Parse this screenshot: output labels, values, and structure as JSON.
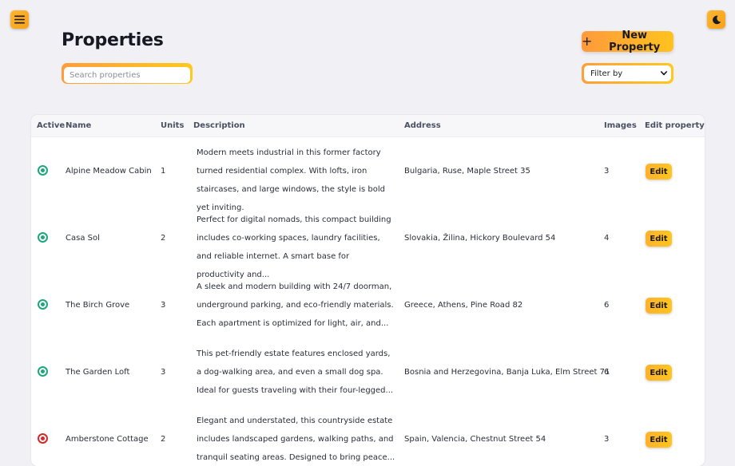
{
  "header": {
    "title": "Properties",
    "new_property_label": "New Property",
    "new_property_icon": "plus-icon",
    "menu_icon": "hamburger-menu-icon",
    "theme_icon": "moon-icon"
  },
  "search": {
    "placeholder": "Search properties",
    "value": ""
  },
  "filter": {
    "selected": "Filter by",
    "icon": "chevron-down-icon"
  },
  "table": {
    "columns": [
      "Active",
      "Name",
      "Units",
      "Description",
      "Address",
      "Images",
      "Edit property"
    ],
    "edit_label": "Edit",
    "rows": [
      {
        "active": true,
        "name": "Alpine Meadow Cabin",
        "units": "1",
        "description": "Modern meets industrial in this former factory turned residential complex. With lofts, iron staircases, and large windows, the style is bold yet inviting.",
        "address": "Bulgaria, Ruse, Maple Street 35",
        "images": "3"
      },
      {
        "active": true,
        "name": "Casa Sol",
        "units": "2",
        "description": "Perfect for digital nomads, this compact building includes co-working spaces, laundry facilities, and reliable internet. A smart base for productivity and...",
        "address": "Slovakia, Žilina, Hickory Boulevard 54",
        "images": "4"
      },
      {
        "active": true,
        "name": "The Birch Grove",
        "units": "3",
        "description": "A sleek and modern building with 24/7 doorman, underground parking, and eco-friendly materials. Each apartment is optimized for light, air, and...",
        "address": "Greece, Athens, Pine Road 82",
        "images": "6"
      },
      {
        "active": true,
        "name": "The Garden Loft",
        "units": "3",
        "description": "This pet-friendly estate features enclosed yards, a dog-walking area, and even a small dog spa. Ideal for guests traveling with their four-legged...",
        "address": "Bosnia and Herzegovina, Banja Luka, Elm Street 71",
        "images": "6"
      },
      {
        "active": false,
        "name": "Amberstone Cottage",
        "units": "2",
        "description": "Elegant and understated, this countryside estate includes landscaped gardens, walking paths, and tranquil seating areas. Designed to bring peace...",
        "address": "Spain, Valencia, Chestnut Street 54",
        "images": "3"
      }
    ]
  },
  "colors": {
    "accent_orange": "#ff9a3c",
    "accent_yellow": "#ffc21e",
    "active_green": "#1fa67a",
    "inactive_red": "#d62828",
    "background": "#f1f1f5"
  }
}
